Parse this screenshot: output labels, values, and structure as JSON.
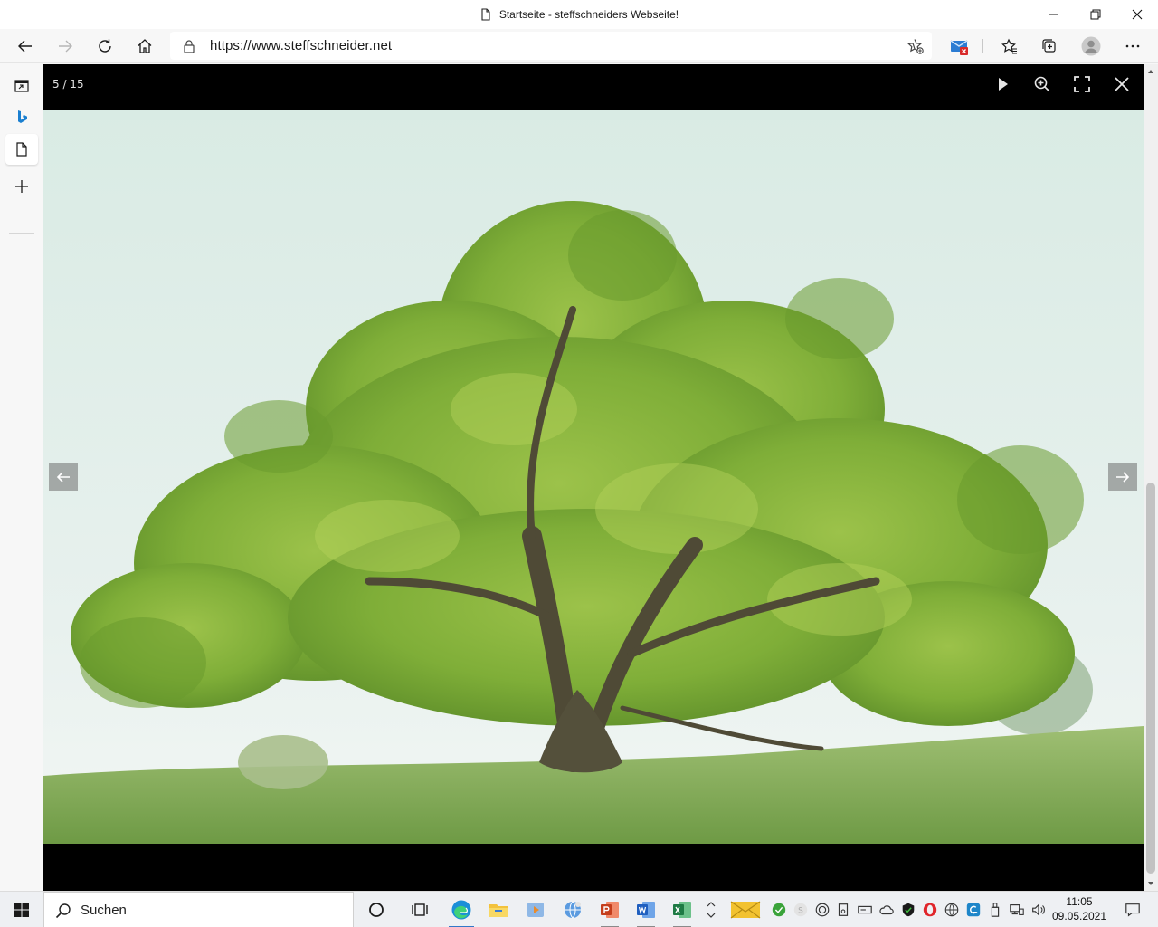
{
  "window": {
    "title": "Startseite - steffschneiders Webseite!"
  },
  "toolbar": {
    "url": "https://www.steffschneider.net"
  },
  "lightbox": {
    "counter": "5 / 15"
  },
  "taskbar": {
    "search_placeholder": "Suchen",
    "time": "11:05",
    "date": "09.05.2021"
  },
  "icons": {
    "back": "back-arrow-icon",
    "forward": "forward-arrow-icon",
    "refresh": "refresh-icon",
    "home": "home-icon",
    "favorites": "favorites-icon",
    "collections": "collections-icon",
    "menu": "more-icon"
  },
  "colors": {
    "lightbox_bg": "#000000",
    "accent": "#3278c8",
    "sky": "#e4eeea",
    "foliage": "#7aa63a",
    "grass": "#8fb060"
  }
}
